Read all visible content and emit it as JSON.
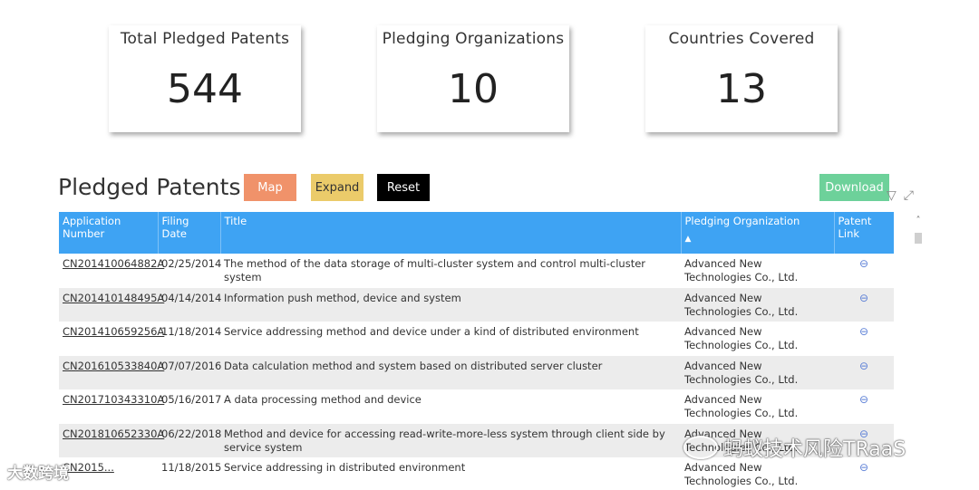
{
  "kpis": [
    {
      "label": "Total Pledged Patents",
      "value": "544"
    },
    {
      "label": "Pledging Organizations",
      "value": "10"
    },
    {
      "label": "Countries Covered",
      "value": "13"
    }
  ],
  "section": {
    "title": "Pledged Patents"
  },
  "buttons": {
    "map": "Map",
    "expand": "Expand",
    "reset": "Reset",
    "download": "Download"
  },
  "colors": {
    "header": "#3EA3F3",
    "map": "#F0926A",
    "expand": "#EBCB6A",
    "reset": "#000000",
    "download": "#6DD19A"
  },
  "table": {
    "headers": [
      "Application Number",
      "Filing Date",
      "Title",
      "Pledging Organization",
      "Patent Link"
    ],
    "rows": [
      {
        "app": "CN201410064882A",
        "date": "02/25/2014",
        "title": "The method of the data storage of multi-cluster system and control multi-cluster system",
        "org": "Advanced New Technologies Co., Ltd.",
        "link": "link-icon"
      },
      {
        "app": "CN201410148495A",
        "date": "04/14/2014",
        "title": "Information push method, device and system",
        "org": "Advanced New Technologies Co., Ltd.",
        "link": "link-icon"
      },
      {
        "app": "CN201410659256A",
        "date": "11/18/2014",
        "title": "Service addressing method and device under a kind of distributed environment",
        "org": "Advanced New Technologies Co., Ltd.",
        "link": "link-icon"
      },
      {
        "app": "CN201610533840A",
        "date": "07/07/2016",
        "title": "Data calculation method and system based on distributed server cluster",
        "org": "Advanced New Technologies Co., Ltd.",
        "link": "link-icon"
      },
      {
        "app": "CN201710343310A",
        "date": "05/16/2017",
        "title": "A data processing method and device",
        "org": "Advanced New Technologies Co., Ltd.",
        "link": "link-icon"
      },
      {
        "app": "CN201810652330A",
        "date": "06/22/2018",
        "title": "Method and device for accessing read-write-more-less system through client side by service system",
        "org": "Advanced New Technologies Co., Ltd.",
        "link": "link-icon"
      },
      {
        "app": "CN2015...",
        "date": "11/18/2015",
        "title": "Service addressing in distributed environment",
        "org": "Advanced New Technologies Co., Ltd.",
        "link": "link-icon"
      }
    ]
  },
  "watermarks": {
    "left": "大数跨境",
    "right": "蚂蚁技术风险TRaaS"
  }
}
